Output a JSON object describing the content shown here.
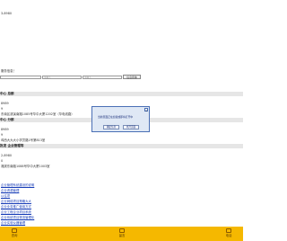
{
  "header": {
    "phone": "3-8980"
  },
  "search": {
    "prompt": "服务信息！",
    "placeholders": [
      "",
      "请输入",
      "请输入"
    ],
    "button_label": "信息查询"
  },
  "sections": [
    {
      "title": "中心 总部",
      "lines": [
        "8989",
        "9",
        "东南区滨溪南路1085号华中大厦1202室（华电线路）"
      ]
    },
    {
      "title": "中心 分部",
      "lines": [
        "8989",
        "9",
        "鸡西大大大小学员路1号第813室"
      ]
    },
    {
      "title": "批发 企业管理等",
      "lines": [
        "2-8980",
        "0",
        "湘滨东南路1088号华中大厦1003室"
      ]
    }
  ],
  "links": [
    "企业管理系统建设的说明",
    "企业资源管理",
    "以往项",
    "企业网络项目策略大大",
    "企业业务推广使用方式",
    "企业工程企业项目系统",
    "企业系统项目物流管理化",
    "企业实验仪器管理"
  ],
  "dialog": {
    "close": "×",
    "message": "当前页面正在加载或即将打开中",
    "ok_label": "确定信息",
    "cancel_label": "离开页面"
  },
  "footer": {
    "items": [
      {
        "label": "咨询",
        "icon": "chat-icon"
      },
      {
        "label": "留言",
        "icon": "message-icon"
      },
      {
        "label": "电话",
        "icon": "phone-icon"
      }
    ]
  }
}
